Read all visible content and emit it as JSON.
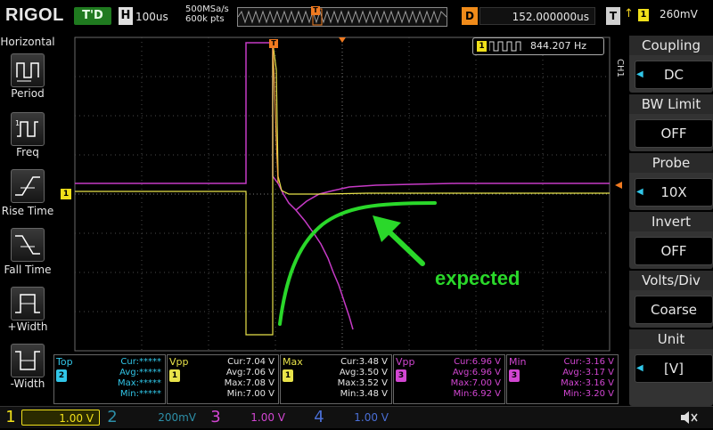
{
  "top": {
    "logo": "RIGOL",
    "run_state": "T'D",
    "h_label": "H",
    "timebase": "100us",
    "sample_rate": "500MSa/s",
    "memory_depth": "600k pts",
    "trig_pos_marker": "T",
    "delay_label": "D",
    "delay_value": "152.000000us",
    "trigger_label": "T",
    "trigger_edge": "↑",
    "trigger_source": "1",
    "trigger_level": "260mV"
  },
  "left_menu": {
    "title": "Horizontal",
    "items": [
      {
        "label": "Period"
      },
      {
        "label": "Freq"
      },
      {
        "label": "Rise Time"
      },
      {
        "label": "Fall Time"
      },
      {
        "label": "+Width"
      },
      {
        "label": "-Width"
      }
    ]
  },
  "right_menu": {
    "channel_tag": "CH1",
    "groups": [
      {
        "title": "Coupling",
        "value": "DC"
      },
      {
        "title": "BW Limit",
        "value": "OFF"
      },
      {
        "title": "Probe",
        "value": "10X"
      },
      {
        "title": "Invert",
        "value": "OFF"
      },
      {
        "title": "Volts/Div",
        "value": "Coarse"
      },
      {
        "title": "Unit",
        "value": "[V]"
      }
    ]
  },
  "screen": {
    "freq_badge": "1",
    "freq_value": "844.207 Hz",
    "ch1_marker": "1",
    "trig_marker": "T",
    "annotation": "expected",
    "colors": {
      "ch1": "#e8e34a",
      "math": "#c63ac6",
      "annotation": "#2ad82a",
      "grid": "#5a5a5a"
    }
  },
  "measurements": [
    {
      "name": "Top",
      "src": "2",
      "color": "#31c6e8",
      "rows": [
        "Cur:*****",
        "Avg:*****",
        "Max:*****",
        "Min:*****"
      ]
    },
    {
      "name": "Vpp",
      "src": "1",
      "color": "#e8e34a",
      "rows": [
        "Cur:7.04 V",
        "Avg:7.06 V",
        "Max:7.08 V",
        "Min:7.00 V"
      ]
    },
    {
      "name": "Max",
      "src": "1",
      "color": "#e8e34a",
      "rows": [
        "Cur:3.48 V",
        "Avg:3.50 V",
        "Max:3.52 V",
        "Min:3.48 V"
      ]
    },
    {
      "name": "Vpp",
      "src": "3",
      "color": "#d246d2",
      "rows": [
        "Cur:6.96 V",
        "Avg:6.96 V",
        "Max:7.00 V",
        "Min:6.92 V"
      ]
    },
    {
      "name": "Min",
      "src": "3",
      "color": "#d246d2",
      "rows": [
        "Cur:-3.16 V",
        "Avg:-3.17 V",
        "Max:-3.16 V",
        "Min:-3.20 V"
      ]
    }
  ],
  "channels": [
    {
      "num": "1",
      "value": "1.00 V",
      "color": "#f0e01a"
    },
    {
      "num": "2",
      "value": "200mV",
      "color": "#2d8fa8"
    },
    {
      "num": "3",
      "value": "1.00 V",
      "color": "#d246d2"
    },
    {
      "num": "4",
      "value": "1.00 V",
      "color": "#4a6fd6"
    }
  ],
  "speaker_icon": "speaker-muted-icon"
}
